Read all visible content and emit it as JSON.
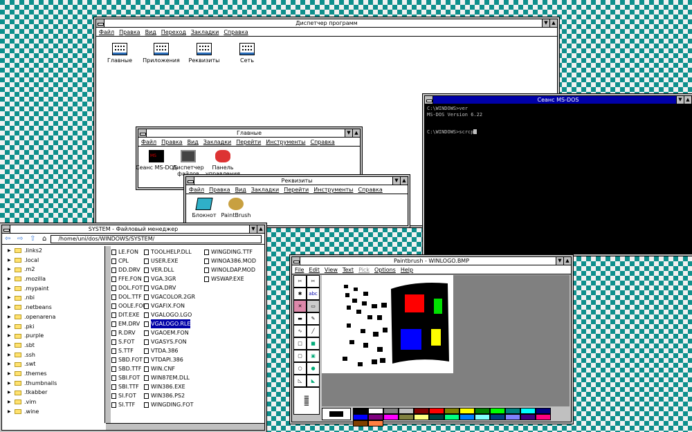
{
  "program_manager": {
    "title": "Диспетчер программ",
    "menu": [
      "Файл",
      "Правка",
      "Вид",
      "Переход",
      "Закладки",
      "Справка"
    ],
    "groups": [
      "Главные",
      "Приложения",
      "Реквизиты",
      "Сеть"
    ]
  },
  "main_group": {
    "title": "Главные",
    "menu": [
      "Файл",
      "Правка",
      "Вид",
      "Закладки",
      "Перейти",
      "Инструменты",
      "Справка"
    ],
    "icons": [
      "Сеанс MS-DOS",
      "Диспетчер файлов",
      "Панель управления"
    ]
  },
  "accessories": {
    "title": "Реквизиты",
    "menu": [
      "Файл",
      "Правка",
      "Вид",
      "Закладки",
      "Перейти",
      "Инструменты",
      "Справка"
    ],
    "icons": [
      "Блокнот",
      "PaintBrush"
    ]
  },
  "dos": {
    "title": "Сеанс MS-DOS",
    "lines": [
      "C:\\WINDOWS>ver",
      "MS-DOS Version 6.22",
      "",
      "C:\\WINDOWS>scrcp"
    ]
  },
  "file_manager": {
    "title": "SYSTEM - Файловый менеджер",
    "path": "/home/uni/dos/WINDOWS/SYSTEM/",
    "tree": [
      ".links2",
      ".local",
      ".m2",
      ".mozilla",
      ".mypaint",
      ".nbi",
      ".netbeans",
      ".openarena",
      ".pki",
      ".purple",
      ".sbt",
      ".ssh",
      ".swt",
      ".themes",
      ".thumbnails",
      ".tkabber",
      ".vim",
      ".wine"
    ],
    "col1": [
      "LE.FON",
      "CPL",
      "DD.DRV",
      "FFE.FON",
      "DOL.FOT",
      "DOL.TTF",
      "OOLE.FON",
      "DIT.EXE",
      "EM.DRV",
      "R.DRV",
      "S.FOT",
      "S.TTF",
      "SBD.FOT",
      "SBD.TTF",
      "SBI.FOT",
      "SBI.TTF",
      "SI.FOT",
      "SI.TTF"
    ],
    "col2": [
      "TOOLHELP.DLL",
      "USER.EXE",
      "VER.DLL",
      "VGA.3GR",
      "VGA.DRV",
      "VGACOLOR.2GR",
      "VGAFIX.FON",
      "VGALOGO.LGO",
      "VGALOGO.RLE",
      "VGAOEM.FON",
      "VGASYS.FON",
      "VTDA.386",
      "VTDAPI.386",
      "WIN.CNF",
      "WIN87EM.DLL",
      "WIN386.EXE",
      "WIN386.PS2",
      "WINGDING.FOT"
    ],
    "col3": [
      "WINGDING.TTF",
      "WINOA386.MOD",
      "WINOLDAP.MOD",
      "WSWAP.EXE"
    ],
    "selected": "VGALOGO.RLE"
  },
  "paintbrush": {
    "title": "Paintbrush - WINLOGO.BMP",
    "menu": [
      "File",
      "Edit",
      "View",
      "Text",
      "Pick",
      "Options",
      "Help"
    ],
    "palette": [
      "#000000",
      "#ffffff",
      "#808080",
      "#c0c0c0",
      "#800000",
      "#ff0000",
      "#808000",
      "#ffff00",
      "#008000",
      "#00ff00",
      "#008080",
      "#00ffff",
      "#000080",
      "#0000ff",
      "#800080",
      "#ff00ff",
      "#808040",
      "#ffff80",
      "#004040",
      "#00ff80",
      "#0080ff",
      "#80ffff",
      "#004080",
      "#8080ff",
      "#400080",
      "#ff0080",
      "#804000",
      "#ff8040"
    ]
  },
  "icons": {
    "window_controls": "up/down triangles",
    "folder": "folder-icon"
  }
}
